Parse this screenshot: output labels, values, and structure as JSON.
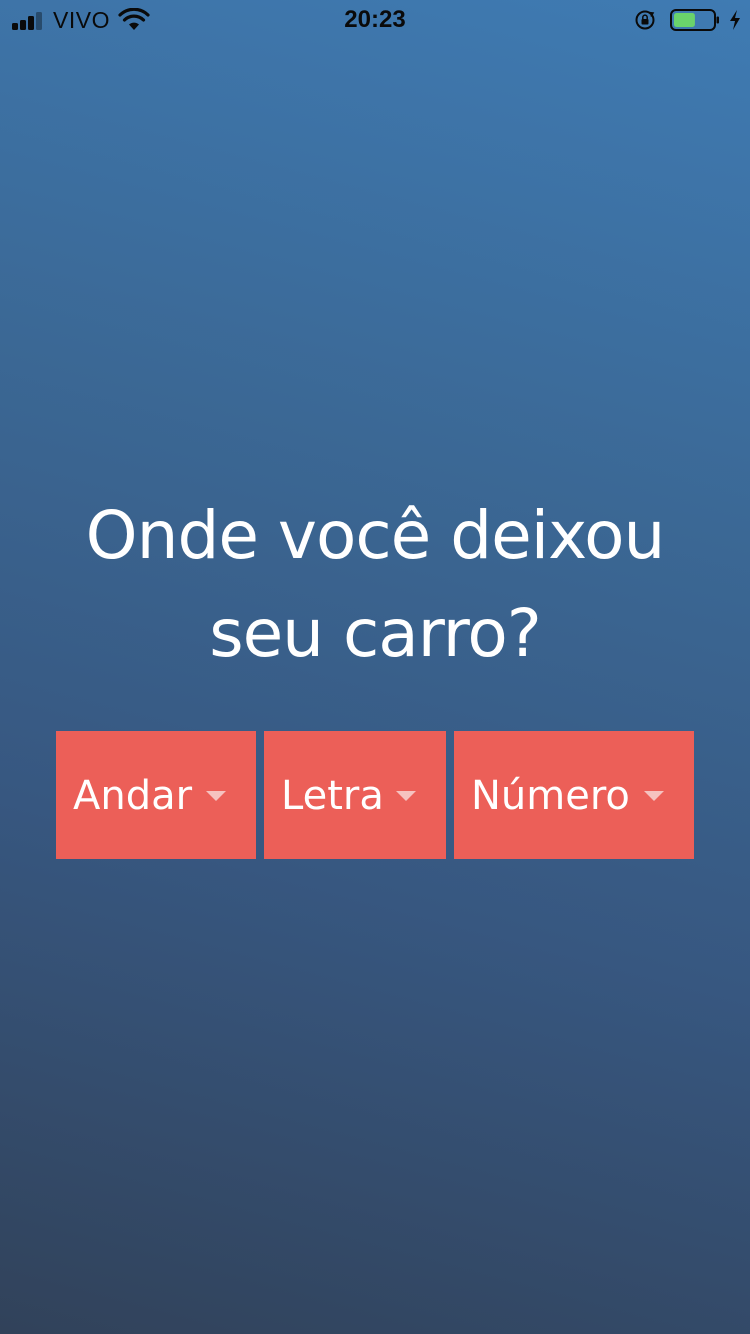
{
  "status_bar": {
    "carrier": "VIVO",
    "time": "20:23",
    "signal_bars_active": 3,
    "signal_bars_total": 4,
    "battery_level": 0.55,
    "charging": true,
    "icons": [
      "signal-icon",
      "wifi-icon",
      "rotation-lock-icon",
      "battery-icon",
      "charging-bolt-icon"
    ]
  },
  "headline": "Onde você deixou\nseu carro?",
  "selectors": [
    {
      "label": "Andar",
      "icon": "caret-down-icon"
    },
    {
      "label": "Letra",
      "icon": "caret-down-icon"
    },
    {
      "label": "Número",
      "icon": "caret-down-icon"
    }
  ],
  "colors": {
    "background_top": "#3f7bb3",
    "background_bottom": "#31425a",
    "button": "#ec5f58",
    "text": "#ffffff",
    "battery_fill": "#6ad36b"
  }
}
